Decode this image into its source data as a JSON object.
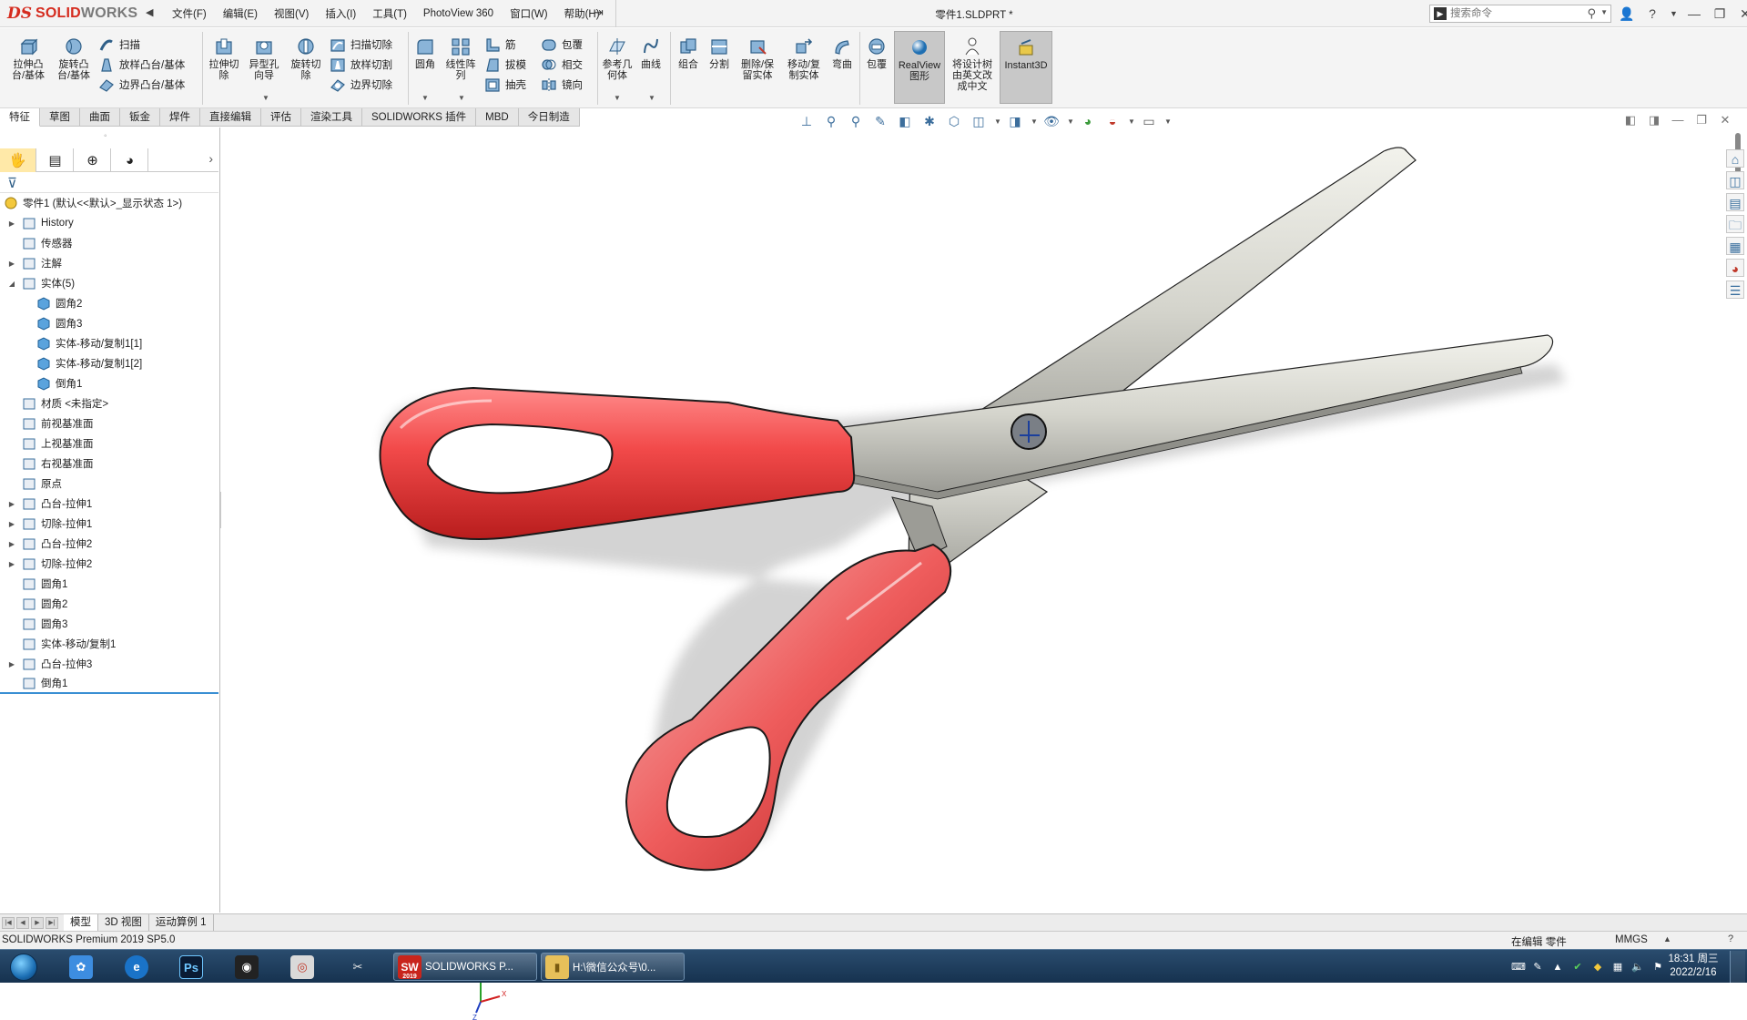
{
  "app": {
    "logo_ds": "DS",
    "logo_solid": "SOLID",
    "logo_works": "WORKS",
    "menus": [
      "文件(F)",
      "编辑(E)",
      "视图(V)",
      "插入(I)",
      "工具(T)",
      "PhotoView 360",
      "窗口(W)",
      "帮助(H)"
    ],
    "document_title": "零件1.SLDPRT *",
    "search_placeholder": "搜索命令",
    "brand_color": "#d52b1e"
  },
  "toolbar": {
    "extrude_boss": "拉伸凸台/基体",
    "revolve_boss": "旋转凸台/基体",
    "sweep": "扫描",
    "loft": "放样凸台/基体",
    "boundary": "边界凸台/基体",
    "extrude_cut": "拉伸切除",
    "hole_wizard": "异型孔向导",
    "revolve_cut": "旋转切除",
    "swept_cut": "扫描切除",
    "lofted_cut": "放样切割",
    "boundary_cut": "边界切除",
    "fillet": "圆角",
    "linear_pattern": "线性阵列",
    "rib": "筋",
    "draft": "拔模",
    "shell": "抽壳",
    "wrap": "包覆",
    "intersect": "相交",
    "mirror": "镜向",
    "reference_geometry": "参考几何体",
    "curves": "曲线",
    "combine": "组合",
    "split": "分割",
    "delete_keep_body": "删除/保留实体",
    "move_copy_body": "移动/复制实体",
    "flex": "弯曲",
    "wrap2": "包覆",
    "realview": "RealView图形",
    "translate_tree": "将设计树由英文改成中文",
    "instant3d": "Instant3D"
  },
  "command_tabs": [
    "特征",
    "草图",
    "曲面",
    "钣金",
    "焊件",
    "直接编辑",
    "评估",
    "渲染工具",
    "SOLIDWORKS 插件",
    "MBD",
    "今日制造"
  ],
  "feature_tree": {
    "root": "零件1 (默认<<默认>_显示状态 1>)",
    "items": [
      {
        "label": "History",
        "level": 1,
        "expandable": true
      },
      {
        "label": "传感器",
        "level": 1,
        "expandable": false
      },
      {
        "label": "注解",
        "level": 1,
        "expandable": true
      },
      {
        "label": "实体(5)",
        "level": 1,
        "expandable": true,
        "expanded": true
      },
      {
        "label": "圆角2",
        "level": 2,
        "expandable": false
      },
      {
        "label": "圆角3",
        "level": 2,
        "expandable": false
      },
      {
        "label": "实体-移动/复制1[1]",
        "level": 2,
        "expandable": false
      },
      {
        "label": "实体-移动/复制1[2]",
        "level": 2,
        "expandable": false
      },
      {
        "label": "倒角1",
        "level": 2,
        "expandable": false
      },
      {
        "label": "材质 <未指定>",
        "level": 1,
        "expandable": false
      },
      {
        "label": "前视基准面",
        "level": 1,
        "expandable": false
      },
      {
        "label": "上视基准面",
        "level": 1,
        "expandable": false
      },
      {
        "label": "右视基准面",
        "level": 1,
        "expandable": false
      },
      {
        "label": "原点",
        "level": 1,
        "expandable": false
      },
      {
        "label": "凸台-拉伸1",
        "level": 1,
        "expandable": true
      },
      {
        "label": "切除-拉伸1",
        "level": 1,
        "expandable": true
      },
      {
        "label": "凸台-拉伸2",
        "level": 1,
        "expandable": true
      },
      {
        "label": "切除-拉伸2",
        "level": 1,
        "expandable": true
      },
      {
        "label": "圆角1",
        "level": 1,
        "expandable": false
      },
      {
        "label": "圆角2",
        "level": 1,
        "expandable": false
      },
      {
        "label": "圆角3",
        "level": 1,
        "expandable": false
      },
      {
        "label": "实体-移动/复制1",
        "level": 1,
        "expandable": false
      },
      {
        "label": "凸台-拉伸3",
        "level": 1,
        "expandable": true
      },
      {
        "label": "倒角1",
        "level": 1,
        "expandable": false
      }
    ]
  },
  "bottom_tabs": [
    "模型",
    "3D 视图",
    "运动算例 1"
  ],
  "status": {
    "product": "SOLIDWORKS Premium 2019 SP5.0",
    "mode": "在编辑 零件",
    "units": "MMGS"
  },
  "taskbar": {
    "apps": [
      {
        "label": "SOLIDWORKS P...",
        "icon": "solidworks-icon"
      },
      {
        "label": "H:\\微信公众号\\0...",
        "icon": "folder-icon"
      }
    ],
    "sw_year": "2019",
    "time": "18:31 周三",
    "date": "2022/2/16"
  },
  "triad": {
    "x": "X",
    "y": "Y",
    "z": "Z"
  }
}
